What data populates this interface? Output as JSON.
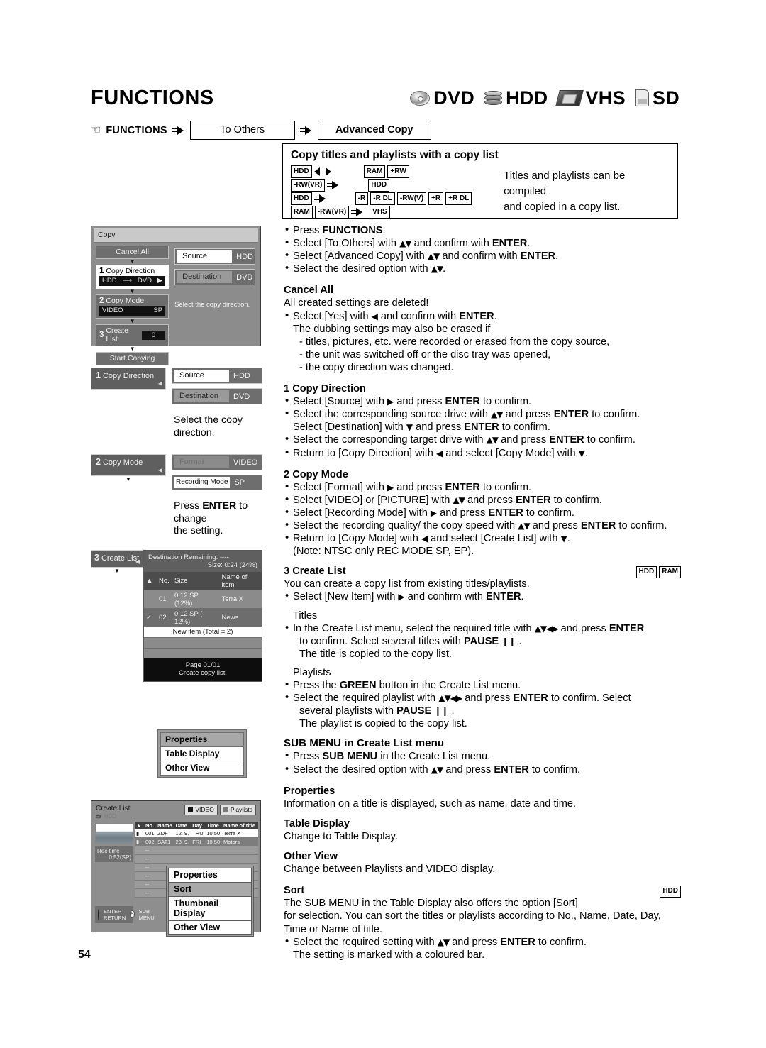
{
  "header": {
    "title": "FUNCTIONS",
    "media": [
      {
        "icon": "dvd-disc-icon",
        "label": "DVD"
      },
      {
        "icon": "hdd-platters-icon",
        "label": "HDD"
      },
      {
        "icon": "vhs-cassette-icon",
        "label": "VHS"
      },
      {
        "icon": "sd-card-icon",
        "label": "SD"
      }
    ]
  },
  "breadcrumb": {
    "hand_icon": "pointing-hand-icon",
    "root": "FUNCTIONS",
    "step1": "To Others",
    "step2": "Advanced Copy"
  },
  "info_panel": {
    "title": "Copy titles and playlists with a copy list",
    "rows": [
      {
        "from": [
          "HDD"
        ],
        "arrow": "both",
        "to": [
          "RAM",
          "+RW"
        ]
      },
      {
        "from": [
          "-RW(VR)"
        ],
        "arrow": "right",
        "to": [
          "HDD"
        ]
      },
      {
        "from": [
          "HDD"
        ],
        "arrow": "right",
        "to": [
          "-R",
          "-R DL",
          "-RW(V)",
          "+R",
          "+R DL"
        ]
      },
      {
        "from": [
          "RAM",
          "-RW(VR)"
        ],
        "arrow": "right",
        "to": [
          "VHS"
        ]
      }
    ],
    "note_line1": "Titles and playlists can be compiled",
    "note_line2": "and copied in a copy list."
  },
  "intro_steps": [
    "Press FUNCTIONS.",
    "Select [To Others] with ▲▼ and confirm with ENTER.",
    "Select [Advanced Copy] with ▲▼ and confirm with ENTER.",
    "Select the desired option with ▲▼."
  ],
  "sections": {
    "cancel_all": {
      "heading": "Cancel All",
      "line1": "All created settings are deleted!",
      "bullet1": "Select [Yes] with ◀ and confirm with ENTER.",
      "sub1": "The dubbing settings may also be erased if",
      "dash1": "- titles, pictures, etc. were recorded or erased from the copy source,",
      "dash2": "- the unit was switched off or the disc tray was opened,",
      "dash3": "- the copy direction was changed."
    },
    "copy_direction": {
      "heading_num": "1",
      "heading": "Copy Direction",
      "b1": "Select [Source] with ▶ and press ENTER to confirm.",
      "b2": "Select the corresponding source drive with ▲▼ and press ENTER to confirm.",
      "b2b": "Select [Destination] with ▼ and press ENTER to confirm.",
      "b3": "Select the corresponding target drive with ▲▼ and press ENTER to confirm.",
      "b4": "Return to [Copy Direction] with ◀ and select [Copy Mode] with ▼."
    },
    "copy_mode": {
      "heading_num": "2",
      "heading": "Copy Mode",
      "b1": "Select [Format] with ▶ and press ENTER to confirm.",
      "b2": "Select [VIDEO] or [PICTURE] with ▲▼ and press ENTER to confirm.",
      "b3": "Select [Recording Mode] with ▶ and press ENTER to confirm.",
      "b4": "Select the recording quality/ the copy speed with ▲▼ and press ENTER to confirm.",
      "b5": "Return to [Copy Mode] with ◀ and select [Create List] with ▼.",
      "note": "(Note: NTSC only REC MODE SP, EP)."
    },
    "create_list": {
      "heading_num": "3",
      "heading": "Create List",
      "badges": [
        "HDD",
        "RAM"
      ],
      "line1": "You can create a copy list from existing titles/playlists.",
      "b1": "Select [New Item] with ▶ and confirm with ENTER.",
      "titles_h": "Titles",
      "t1a": "In the Create List menu, select the required title with ▲▼◀▶ and press ENTER",
      "t1b": "to confirm. Select several titles with PAUSE ‖ .",
      "t2": "The title is copied to the copy list.",
      "playlists_h": "Playlists",
      "p1": "Press the GREEN button in the Create List menu.",
      "p2a": "Select the required playlist with ▲▼◀▶ and press ENTER to confirm. Select",
      "p2b": "several playlists with PAUSE ‖ .",
      "p3": "The playlist is copied to the copy list."
    },
    "sub_menu": {
      "heading": "SUB MENU in Create List menu",
      "b1": "Press SUB MENU in the Create List menu.",
      "b2": "Select the desired option with ▲▼ and press ENTER to confirm."
    },
    "properties": {
      "heading": "Properties",
      "text": "Information on a title is displayed, such as name, date and time."
    },
    "table_display": {
      "heading": "Table Display",
      "text": "Change to Table Display."
    },
    "other_view": {
      "heading": "Other View",
      "text": "Change between Playlists and VIDEO display."
    },
    "sort": {
      "heading": "Sort",
      "badge": "HDD",
      "l1": "The SUB MENU in the Table Display also offers the option [Sort]",
      "l2": "for selection. You can sort the titles or playlists according to No., Name, Date, Day,",
      "l3": "Time or Name of title.",
      "b1": "Select the required setting with ▲▼ and press ENTER to confirm.",
      "b2": "The setting is marked with a coloured bar."
    }
  },
  "screens": {
    "copy_main": {
      "title": "Copy",
      "cancel_all": "Cancel All",
      "step1_num": "1",
      "step1_label": "Copy Direction",
      "step1_from": "HDD",
      "step1_to": "DVD",
      "step2_num": "2",
      "step2_label": "Copy Mode",
      "step2_format": "VIDEO",
      "step2_mode": "SP",
      "step3_num": "3",
      "step3_label": "Create List",
      "step3_count": "0",
      "start": "Start Copying",
      "source_key": "Source",
      "source_val": "HDD",
      "dest_key": "Destination",
      "dest_val": "DVD",
      "hint": "Select the copy direction."
    },
    "copy_direction": {
      "num": "1",
      "label": "Copy Direction",
      "source_key": "Source",
      "source_val": "HDD",
      "dest_key": "Destination",
      "dest_val": "DVD",
      "caption": "Select the copy direction."
    },
    "copy_mode": {
      "num": "2",
      "label": "Copy Mode",
      "format_key": "Format",
      "format_val": "VIDEO",
      "recmode_key": "Recording Mode",
      "recmode_val": "SP",
      "caption_a": "Press ",
      "caption_b": "ENTER",
      "caption_c": " to change",
      "caption_d": "the setting."
    },
    "create_list": {
      "num": "3",
      "label": "Create List",
      "dest_remaining_label": "Destination Remaining:",
      "dest_remaining_val": "----",
      "size_label": "Size:",
      "size_val": "0:24 (24%)",
      "columns": [
        "No.",
        "Size",
        "Name of item"
      ],
      "rows": [
        {
          "check": "",
          "no": "01",
          "size": "0:12 SP (12%)",
          "name": "Terra X"
        },
        {
          "check": "✓",
          "no": "02",
          "size": "0:12 SP ( 12%)",
          "name": "News"
        }
      ],
      "new_item": "New item (Total = 2)",
      "page": "Page 01/01",
      "footer": "Create copy list."
    },
    "submenu_small": {
      "items": [
        {
          "label": "Properties",
          "highlight": true
        },
        {
          "label": "Table Display",
          "highlight": false
        },
        {
          "label": "Other View",
          "highlight": false
        }
      ]
    },
    "create_list_big": {
      "title": "Create List",
      "subtitle": "HDD",
      "chip_video": "VIDEO",
      "chip_playlists": "Playlists",
      "columns": [
        "No.",
        "Name",
        "Date",
        "Day",
        "Time",
        "Name of title"
      ],
      "rows": [
        {
          "no": "001",
          "name": "ZDF",
          "date": "12. 9.",
          "day": "THU",
          "time": "10:50",
          "title": "Terra X"
        },
        {
          "no": "002",
          "name": "SAT1",
          "date": "23. 9.",
          "day": "FRI",
          "time": "10:50",
          "title": "Motors"
        }
      ],
      "rec_time_label": "Rec time",
      "rec_time_val": "0:52(SP)",
      "enter_label": "ENTER",
      "return_label": "RETURN",
      "submenu_label": "SUB MENU",
      "submenu_items": [
        {
          "label": "Properties",
          "highlight": false
        },
        {
          "label": "Sort",
          "highlight": true
        },
        {
          "label": "Thumbnail Display",
          "highlight": false
        },
        {
          "label": "Other View",
          "highlight": false
        }
      ]
    }
  },
  "page_number": "54"
}
